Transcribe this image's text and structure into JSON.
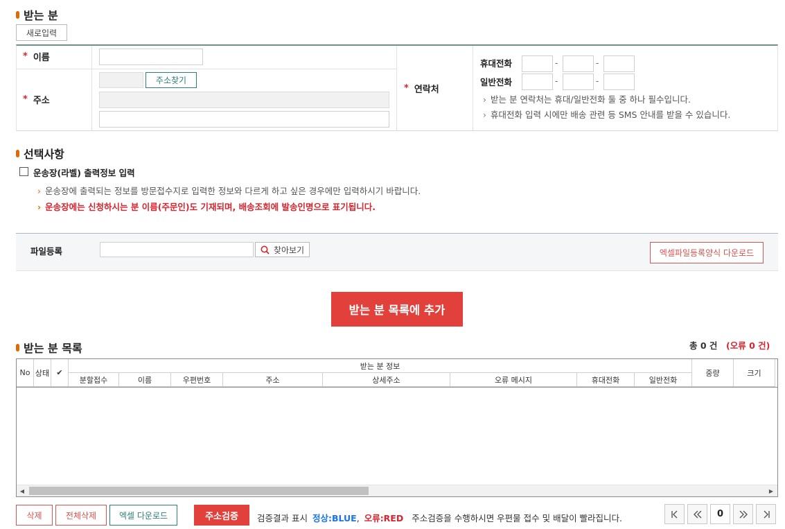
{
  "recipient": {
    "title": "받는 분",
    "new_entry_btn": "새로입력",
    "name_label": "이름",
    "address_label": "주소",
    "find_address_btn": "주소찾기",
    "contact_label": "연락처",
    "mobile_label": "휴대전화",
    "landline_label": "일반전화",
    "dash": "-",
    "note1": "받는 분 연락처는 휴대/일반전화 둘 중 하나 필수입니다.",
    "note2": "휴대전화 입력 시에만 배송 관련 등 SMS 안내를 받을 수 있습니다.",
    "required_mark": "*",
    "hint_arrow": "›"
  },
  "options": {
    "title": "선택사항",
    "label_checkbox": "운송장(라벨) 출력정보 입력",
    "label_checked": false,
    "note1": "운송장에 출력되는 정보를 방문접수지로 입력한 정보와 다르게 하고 싶은 경우에만 입력하시기 바랍니다.",
    "note2": "운송장에는 신청하시는 분 이름(주문인)도 기재되며, 배송조회에 발송인명으로 표기됩니다."
  },
  "file": {
    "label": "파일등록",
    "input_value": "",
    "browse_btn": "찾아보기",
    "excel_template_btn": "엑셀파일등록양식 다운로드"
  },
  "add_btn": "받는 분 목록에 추가",
  "list": {
    "title": "받는 분 목록",
    "total_text": "총 0 건",
    "error_text": "(오류 0 건)",
    "columns_top": {
      "no": "No",
      "status": "상태",
      "check": "✔",
      "group": "받는 분 정보",
      "weight": "중량",
      "size": "크기"
    },
    "columns_sub": [
      "분할접수",
      "이름",
      "우편번호",
      "주소",
      "상세주소",
      "오류 메시지",
      "휴대전화",
      "일반전화"
    ],
    "rows": []
  },
  "bottom": {
    "delete_btn": "삭제",
    "delete_all_btn": "전체삭제",
    "excel_download_btn": "엑셀 다운로드",
    "verify_btn": "주소검증",
    "result_prefix": "검증결과 표시",
    "normal_label": "정상:BLUE",
    "separator": ",",
    "error_label": "오류:RED",
    "verify_note": "주소검증을 수행하시면 우편물 접수 및 배달이 빨라집니다.",
    "page_current": "0"
  },
  "colors": {
    "accent_orange": "#e06a00",
    "red": "#e2403a",
    "blue": "#1a73e8",
    "teal": "#2a7f7a"
  },
  "icons": {
    "first": "first-page-icon",
    "prev": "prev-page-icon",
    "next": "next-page-icon",
    "last": "last-page-icon",
    "search": "search-icon"
  }
}
